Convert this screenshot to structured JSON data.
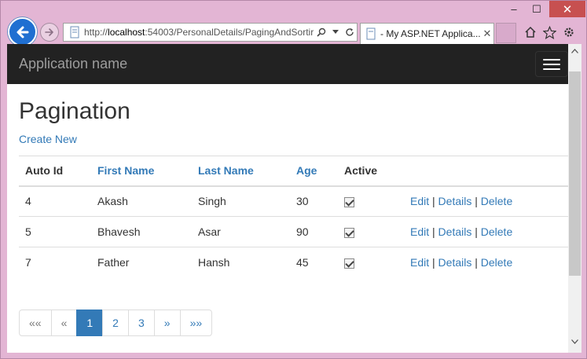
{
  "browser": {
    "url_prefix": "http://",
    "url_host": "localhost",
    "url_rest": ":54003/PersonalDetails/PagingAndSortir",
    "tab_title": "- My ASP.NET Applica...",
    "window_controls": {
      "minimize": "–",
      "maximize": "☐",
      "close": "✕"
    },
    "icons": [
      "back-icon",
      "forward-icon",
      "search-icon",
      "dropdown-icon",
      "refresh-icon",
      "home-icon",
      "favorites-icon",
      "settings-icon"
    ]
  },
  "navbar": {
    "brand": "Application name"
  },
  "page": {
    "title": "Pagination",
    "create_link": "Create New"
  },
  "table": {
    "headers": [
      {
        "label": "Auto Id",
        "link": false
      },
      {
        "label": "First Name",
        "link": true
      },
      {
        "label": "Last Name",
        "link": true
      },
      {
        "label": "Age",
        "link": true
      },
      {
        "label": "Active",
        "link": false
      }
    ],
    "rows": [
      {
        "id": "4",
        "first": "Akash",
        "last": "Singh",
        "age": "30",
        "active": true
      },
      {
        "id": "5",
        "first": "Bhavesh",
        "last": "Asar",
        "age": "90",
        "active": true
      },
      {
        "id": "7",
        "first": "Father",
        "last": "Hansh",
        "age": "45",
        "active": true
      }
    ],
    "actions": {
      "edit": "Edit",
      "details": "Details",
      "delete": "Delete",
      "separator": "|"
    }
  },
  "pager": {
    "items": [
      {
        "label": "««",
        "state": "disabled"
      },
      {
        "label": "«",
        "state": "disabled"
      },
      {
        "label": "1",
        "state": "active"
      },
      {
        "label": "2",
        "state": "normal"
      },
      {
        "label": "3",
        "state": "normal"
      },
      {
        "label": "»",
        "state": "normal"
      },
      {
        "label": "»»",
        "state": "normal"
      }
    ]
  },
  "colors": {
    "link": "#337ab7",
    "navbar": "#222222",
    "active_page": "#337ab7",
    "close_button": "#c75050"
  }
}
